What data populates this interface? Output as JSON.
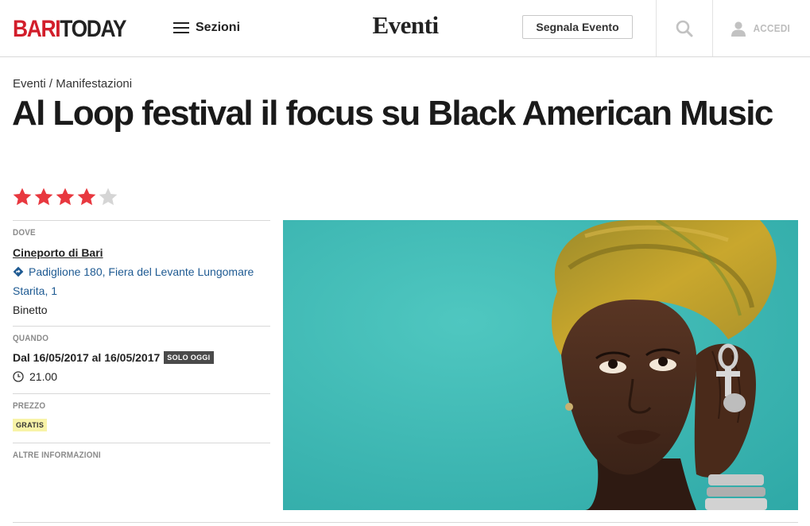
{
  "header": {
    "logo_part1": "BARI",
    "logo_part2": "TODAY",
    "menu_label": "Sezioni",
    "section_title": "Eventi",
    "report_button": "Segnala Evento",
    "search_icon": "search-icon",
    "login_label": "ACCEDI",
    "login_icon": "user-icon",
    "brand_color": "#d21e2b"
  },
  "breadcrumb": {
    "item1": "Eventi",
    "separator": " / ",
    "item2": "Manifestazioni"
  },
  "event": {
    "title": "Al Loop festival il focus su Black American Music",
    "rating": {
      "value": 4,
      "max": 5,
      "filled_color": "#e8383f",
      "empty_color": "#d5d5d5"
    }
  },
  "info": {
    "where_label": "DOVE",
    "venue": "Cineporto di Bari",
    "address": "Padiglione 180, Fiera del Levante Lungomare Starita, 1",
    "address_icon": "directions-icon",
    "city": "Binetto",
    "when_label": "QUANDO",
    "dates": "Dal 16/05/2017 al 16/05/2017",
    "today_badge": "SOLO OGGI",
    "time_icon": "clock-icon",
    "time": "21.00",
    "price_label": "PREZZO",
    "price_badge": "GRATIS",
    "more_label": "ALTRE INFORMAZIONI"
  },
  "hero": {
    "image_label": "event-photo"
  }
}
